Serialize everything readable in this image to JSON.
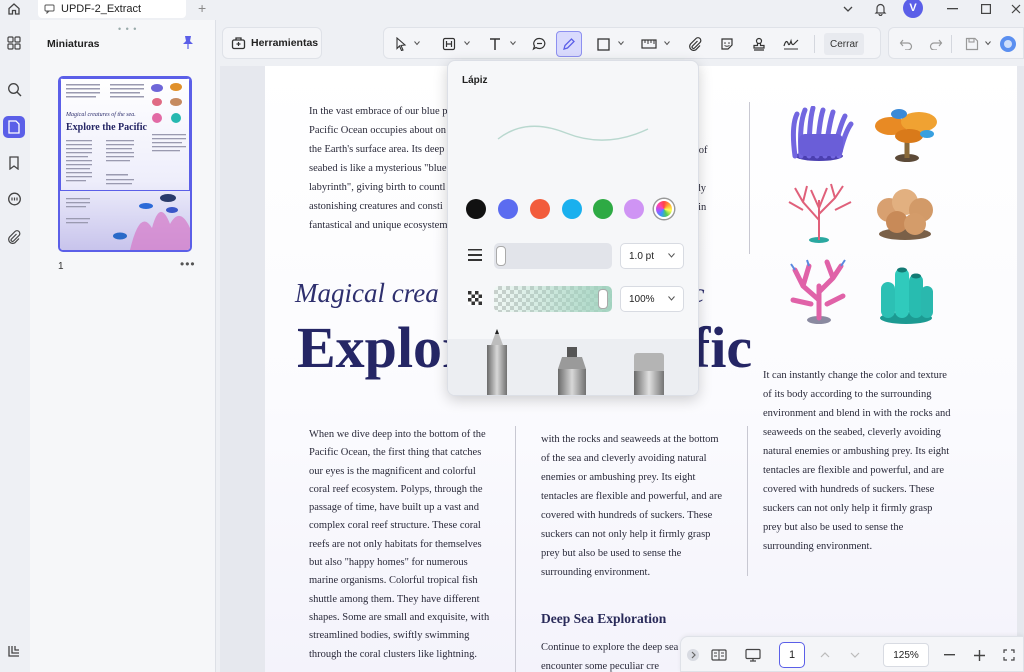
{
  "app": {
    "tab_title": "UPDF-2_Extract",
    "avatar_initial": "V"
  },
  "thumbnails": {
    "title": "Miniaturas",
    "page_number": "1",
    "mini_subtitle": "Magical creatures of the sea.",
    "mini_title": "Explore the Pacific"
  },
  "toolbar": {
    "tools_label": "Herramientas",
    "close_label": "Cerrar"
  },
  "pencil_popup": {
    "title": "Lápiz",
    "colors": [
      "#111111",
      "#5b6cf0",
      "#f25c3c",
      "#1ab0ee",
      "#2eaa44",
      "#cf94f4"
    ],
    "thickness_value": "1.0 pt",
    "opacity_value": "100%"
  },
  "document": {
    "intro_lines": [
      "In the vast embrace of our blue p",
      "Pacific Ocean occupies about on",
      "the Earth's surface area. Its deep",
      "seabed is like a mysterious \"blue",
      "labyrinth\", giving birth to countl",
      "astonishing creatures and consti",
      "fantastical and unique ecosystem"
    ],
    "intro_tail_lines": [
      "ar",
      "ter of",
      "nly",
      "body",
      "ng in"
    ],
    "subtitle_visible": "Magical crea",
    "subtitle_tail": "ic",
    "title_visible": "Explor",
    "title_tail": "fic",
    "col1": "When we dive deep into the bottom of the Pacific Ocean, the first thing that catches our eyes is the magnificent and colorful coral reef ecosystem. Polyps, through the passage of time, have built up a vast and complex coral reef structure. These coral reefs are not only habitats for themselves but also \"happy homes\" for numerous marine organisms. Colorful tropical fish shuttle among them. They have different shapes. Some are small and exquisite, with streamlined bodies, swiftly swimming through the coral clusters like lightning.",
    "col2": "with the rocks and seaweeds at the bottom of the sea and cleverly avoiding natural enemies or ambushing prey. Its eight tentacles are flexible and powerful, and are covered with hundreds of suckers. These suckers can not only help it firmly grasp prey but also be used to sense the surrounding environment.",
    "col3": "It can instantly change the color and texture of its body according to the surrounding environment and blend in with the rocks and seaweeds on the seabed, cleverly avoiding natural enemies or ambushing prey. Its eight tentacles are flexible and powerful, and are covered with hundreds of suckers. These suckers can not only help it firmly grasp prey but also be used to sense the surrounding environment.",
    "section_title": "Deep Sea Exploration",
    "section_text": "Continue to explore the deep sea will encounter some peculiar cre"
  },
  "navigation": {
    "current_page": "1",
    "zoom": "125%"
  }
}
